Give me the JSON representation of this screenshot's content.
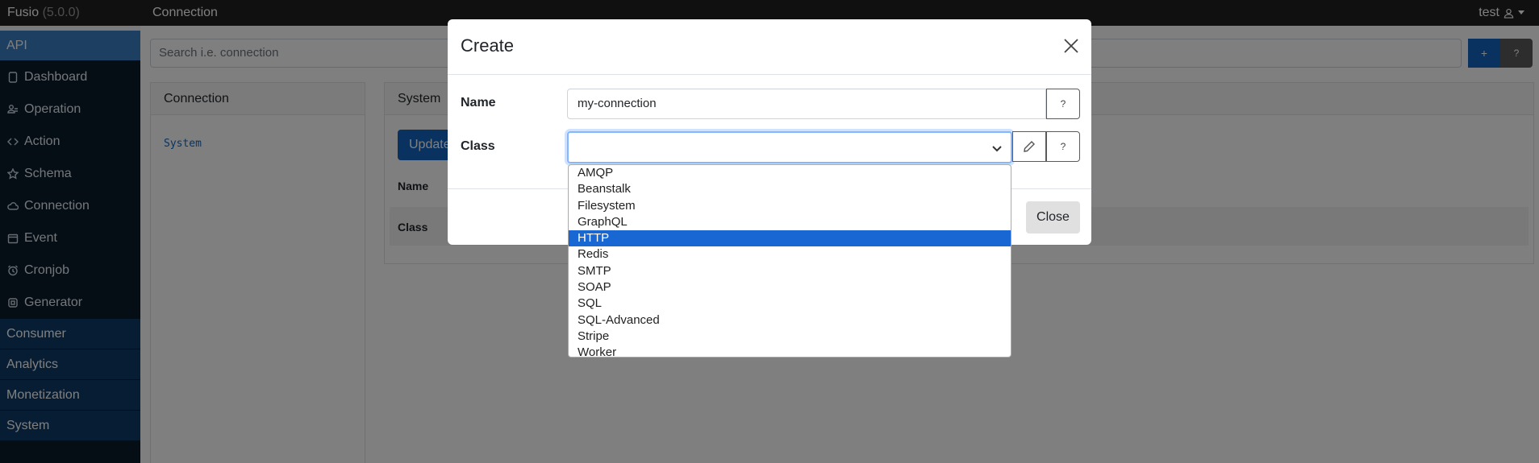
{
  "app": {
    "brand": "Fusio",
    "version": "(5.0.0)",
    "page_title": "Connection",
    "user": "test"
  },
  "sidebar": {
    "groups": {
      "api": "API",
      "consumer": "Consumer",
      "analytics": "Analytics",
      "monetization": "Monetization",
      "system": "System"
    },
    "items": [
      {
        "label": "Dashboard",
        "icon": "tablet-icon"
      },
      {
        "label": "Operation",
        "icon": "operation-icon"
      },
      {
        "label": "Action",
        "icon": "code-icon"
      },
      {
        "label": "Schema",
        "icon": "star-icon"
      },
      {
        "label": "Connection",
        "icon": "cloud-icon"
      },
      {
        "label": "Event",
        "icon": "calendar-icon"
      },
      {
        "label": "Cronjob",
        "icon": "alarm-icon"
      },
      {
        "label": "Generator",
        "icon": "cpu-icon"
      }
    ]
  },
  "main": {
    "search_placeholder": "Search i.e. connection",
    "add_label": "+",
    "help_label": "?",
    "left_card": {
      "title": "Connection",
      "link": "System"
    },
    "right_card": {
      "title": "System",
      "update_label": "Update",
      "name_label": "Name",
      "class_label": "Class"
    }
  },
  "modal": {
    "title": "Create",
    "name_label": "Name",
    "name_value": "my-connection",
    "class_label": "Class",
    "help_label": "?",
    "close_label": "Close",
    "options": [
      "AMQP",
      "Beanstalk",
      "Filesystem",
      "GraphQL",
      "HTTP",
      "Redis",
      "SMTP",
      "SOAP",
      "SQL",
      "SQL-Advanced",
      "Stripe",
      "Worker"
    ],
    "selected_option": "HTTP"
  }
}
